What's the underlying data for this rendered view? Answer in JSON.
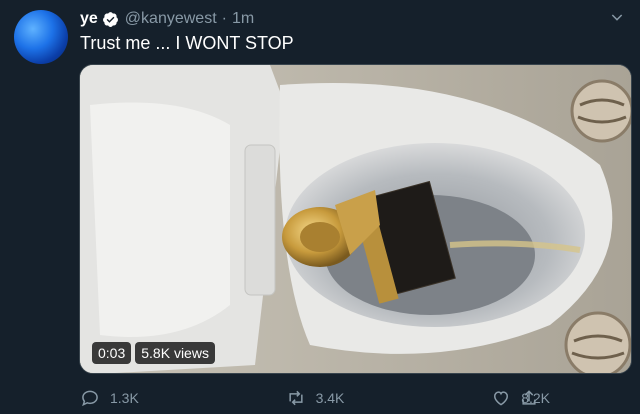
{
  "tweet": {
    "display_name": "ye",
    "handle": "@kanyewest",
    "separator": "·",
    "time": "1m",
    "text": "Trust me ... I WONT STOP"
  },
  "video": {
    "duration": "0:03",
    "views": "5.8K views"
  },
  "actions": {
    "reply_count": "1.3K",
    "retweet_count": "3.4K",
    "like_count": "8.2K"
  },
  "icons": {
    "verified": "verified-badge-icon",
    "caret": "chevron-down-icon",
    "reply": "reply-icon",
    "retweet": "retweet-icon",
    "like": "heart-icon",
    "share": "share-icon"
  },
  "colors": {
    "background": "#15202b",
    "text_secondary": "#8899a6",
    "accent": "#1da1f2"
  }
}
